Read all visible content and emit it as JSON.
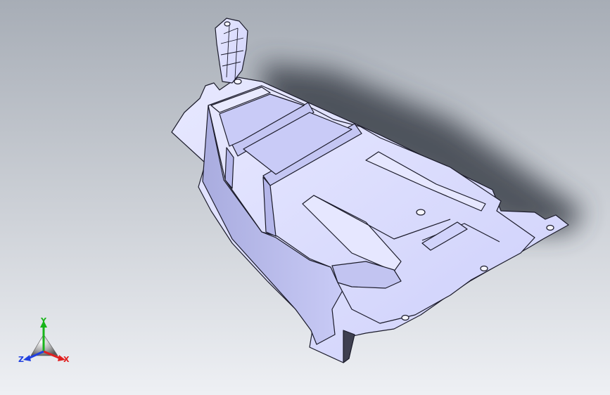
{
  "viewport": {
    "background_top": "#a7adb6",
    "background_bottom": "#eef0f4"
  },
  "part": {
    "type": "stamped sheet-metal bracket",
    "face_color": "#d7d9ff",
    "shade_color": "#b4b6ea",
    "edge_color": "#1b1b2a",
    "shadow_color": "#3a3f4a"
  },
  "triad": {
    "x_label": "X",
    "y_label": "Y",
    "z_label": "Z",
    "x_color": "#e02020",
    "y_color": "#19b41a",
    "z_color": "#2040e0"
  }
}
